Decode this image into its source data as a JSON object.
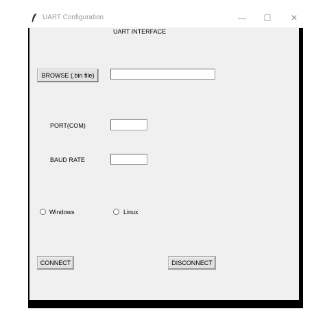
{
  "window": {
    "title": "UART Configuration",
    "minimize_glyph": "—",
    "maximize_glyph": "☐",
    "close_glyph": "✕",
    "app_icon": "feather-icon"
  },
  "frame": {
    "label": "UART INTERFACE"
  },
  "browse": {
    "button_label": "BROWSE (.bin file)",
    "path_value": ""
  },
  "port": {
    "label": "PORT(COM)",
    "value": ""
  },
  "baud": {
    "label": "BAUD RATE",
    "value": ""
  },
  "os_options": {
    "windows_label": "Windows",
    "linux_label": "Linux"
  },
  "actions": {
    "connect_label": "CONNECT",
    "disconnect_label": "DISCONNECT"
  }
}
